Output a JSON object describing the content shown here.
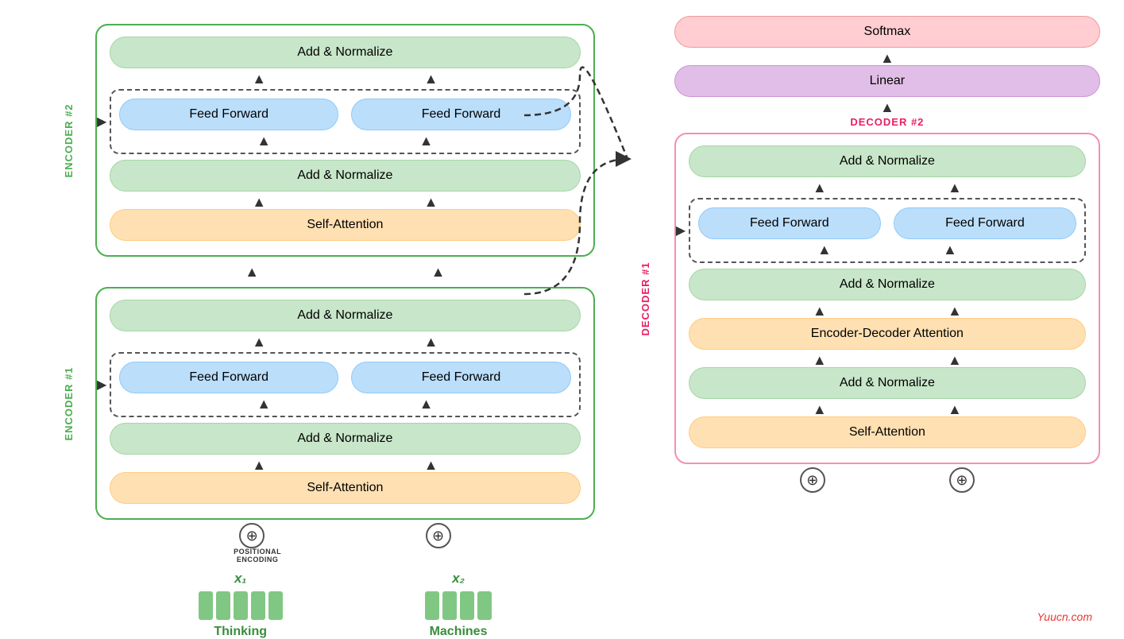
{
  "encoder": {
    "label1": "ENCODER #1",
    "label2": "ENCODER #2",
    "add_norm": "Add & Normalize",
    "feed_forward": "Feed Forward",
    "self_attention": "Self-Attention",
    "positional_encoding": "POSITIONAL\nENCODING"
  },
  "decoder": {
    "label1": "DECODER #1",
    "label2": "DECODER #2",
    "add_norm": "Add & Normalize",
    "feed_forward": "Feed Forward",
    "self_attention": "Self-Attention",
    "enc_dec_attention": "Encoder-Decoder Attention",
    "linear": "Linear",
    "softmax": "Softmax"
  },
  "inputs": {
    "x1_label": "x₁",
    "x2_label": "x₂",
    "word1": "Thinking",
    "word2": "Machines"
  },
  "watermark": "Yuucn.com"
}
